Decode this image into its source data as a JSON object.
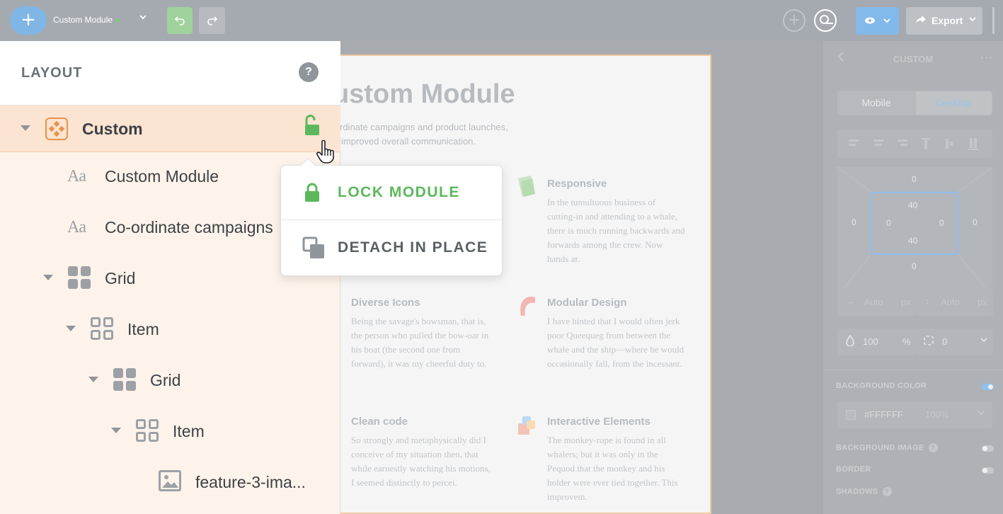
{
  "topbar": {
    "add_icon": "plus-icon",
    "module_name": "Custom Module",
    "status_color": "#7cc87a",
    "preview_icon": "eye-icon",
    "export_label": "Export"
  },
  "layout_panel": {
    "title": "LAYOUT",
    "help": "?",
    "tree": [
      {
        "label": "Custom",
        "icon": "custom-module-icon",
        "selected": true
      },
      {
        "label": "Custom Module",
        "icon": "text-icon"
      },
      {
        "label": "Co-ordinate campaigns",
        "icon": "text-icon"
      },
      {
        "label": "Grid",
        "icon": "grid-icon"
      },
      {
        "label": "Item",
        "icon": "item-icon"
      },
      {
        "label": "Grid",
        "icon": "grid-icon"
      },
      {
        "label": "Item",
        "icon": "item-icon"
      },
      {
        "label": "feature-3-ima...",
        "icon": "image-icon"
      }
    ],
    "text_icon_glyph": "Aa"
  },
  "popover": {
    "lock_label": "LOCK MODULE",
    "detach_label": "DETACH IN PLACE"
  },
  "canvas": {
    "title": "ustom Module",
    "subtitle_1": "rdinate campaigns and product launches,",
    "subtitle_2": "improved overall communication.",
    "features": [
      {
        "title": "Responsive",
        "text": "In the tumultuous business of cutting-in and attending to a whale, there is much running backwards and forwards among the crew. Now hands ar."
      },
      {
        "title": "Diverse Icons",
        "text": "Being the savage's bowsman, that is, the person who pulled the bow-oar in his boat (the second one from forward), it was my cheerful duty to."
      },
      {
        "title": "Modular Design",
        "text": "I have hinted that I would often jerk poor Queequeg from between the whale and the ship—where he would occasionally fall, from the incessant."
      },
      {
        "title": "Clean code",
        "text": "So strongly and metaphysically did I conceive of my situation then, that while earnestly watching his motions, I seemed distinctly to percei."
      },
      {
        "title": "Interactive Elements",
        "text": "The monkey-rope is found in all whalers; but it was only in the Pequod that the monkey and his holder were ever tied together. This improvem."
      }
    ]
  },
  "right_panel": {
    "title": "CUSTOM",
    "more": "···",
    "seg_mobile": "Mobile",
    "seg_desktop": "Desktop",
    "margin": {
      "top": "0",
      "right": "0",
      "bottom": "0",
      "left": "0"
    },
    "padding": {
      "top": "40",
      "right": "0",
      "bottom": "40",
      "left": "0"
    },
    "width_value": "Auto",
    "width_unit": "px",
    "height_value": "Auto",
    "height_unit": "px",
    "opacity_value": "100",
    "opacity_unit": "%",
    "radius_value": "0",
    "bg_color_label": "BACKGROUND COLOR",
    "bg_color_value": "#FFFFFF",
    "bg_color_opacity": "100%",
    "bg_image_label": "BACKGROUND IMAGE",
    "border_label": "BORDER",
    "shadows_label": "SHADOWS"
  },
  "colors": {
    "accent_blue": "#83b9ea",
    "lock_green": "#5cb85c",
    "custom_orange": "#e8924a"
  }
}
